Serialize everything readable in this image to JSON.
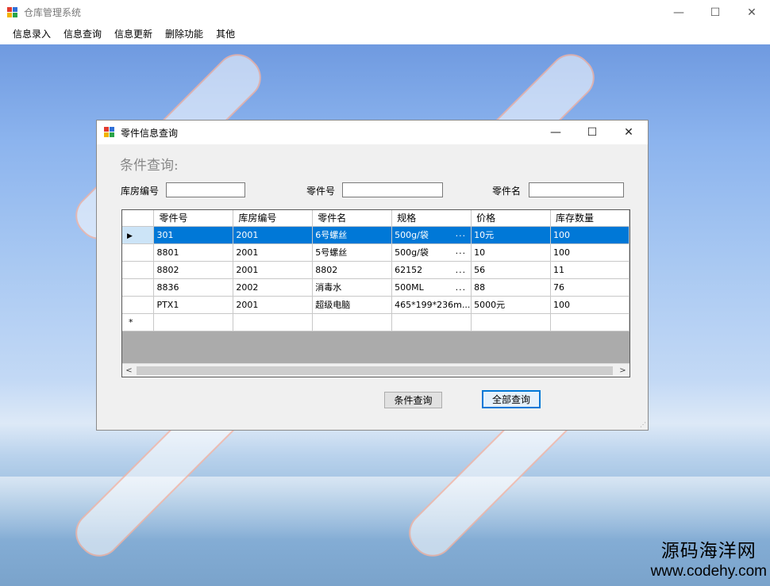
{
  "main_window": {
    "title": "仓库管理系统",
    "minimize_glyph": "—",
    "maximize_glyph": "☐",
    "close_glyph": "✕"
  },
  "menu": [
    "信息录入",
    "信息查询",
    "信息更新",
    "删除功能",
    "其他"
  ],
  "child_window": {
    "title": "零件信息查询",
    "minimize_glyph": "—",
    "maximize_glyph": "☐",
    "close_glyph": "✕"
  },
  "query": {
    "heading": "条件查询:",
    "warehouse_label": "库房编号",
    "warehouse_value": "",
    "part_no_label": "零件号",
    "part_no_value": "",
    "part_name_label": "零件名",
    "part_name_value": ""
  },
  "grid": {
    "columns": [
      "零件号",
      "库房编号",
      "零件名",
      "规格",
      "价格",
      "库存数量"
    ],
    "rows": [
      {
        "part_no": "301",
        "warehouse": "2001",
        "name": "6号螺丝",
        "spec": "500g/袋",
        "spec_more": "...",
        "price": "10元",
        "qty": "100"
      },
      {
        "part_no": "8801",
        "warehouse": "2001",
        "name": "5号螺丝",
        "spec": "500g/袋",
        "spec_more": "...",
        "price": "10",
        "qty": "100"
      },
      {
        "part_no": "8802",
        "warehouse": "2001",
        "name": "8802",
        "spec": "62152",
        "spec_more": "...",
        "price": "56",
        "qty": "11"
      },
      {
        "part_no": "8836",
        "warehouse": "2002",
        "name": "消毒水",
        "spec": "500ML",
        "spec_more": "...",
        "price": "88",
        "qty": "76"
      },
      {
        "part_no": "PTX1",
        "warehouse": "2001",
        "name": "超级电脑",
        "spec": "465*199*236m...",
        "spec_more": "",
        "price": "5000元",
        "qty": "100"
      }
    ],
    "selected_marker": "▶",
    "new_row_marker": "*",
    "scroll_left": "<",
    "scroll_right": ">"
  },
  "buttons": {
    "conditional_query": "条件查询",
    "all_query": "全部查询"
  },
  "watermark": {
    "line1": "源码海洋网",
    "line2": "www.codehy.com"
  },
  "colors": {
    "selection": "#0078d7",
    "default_button_border": "#0078d7"
  }
}
